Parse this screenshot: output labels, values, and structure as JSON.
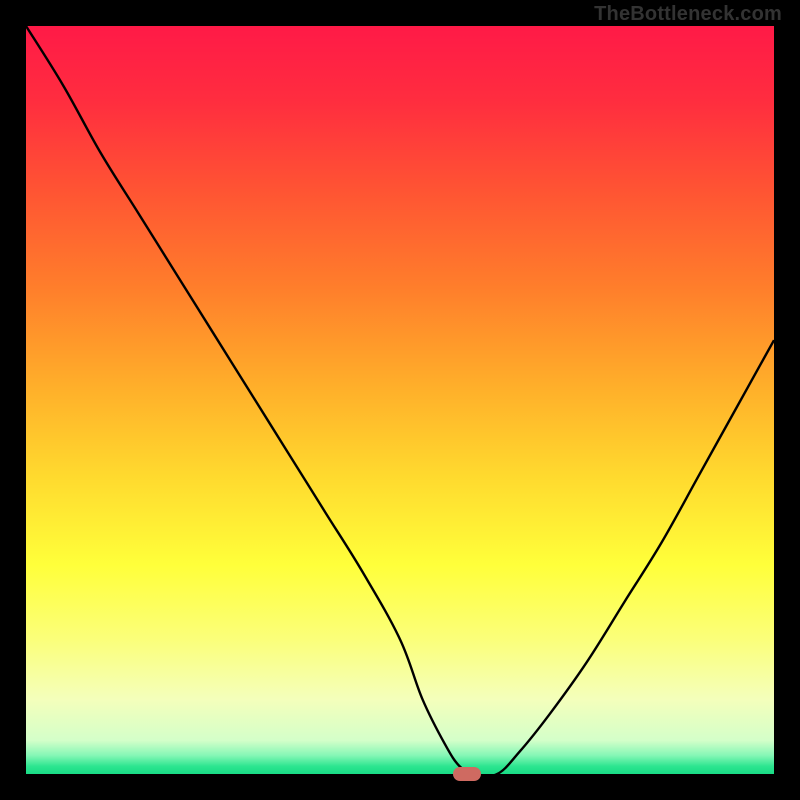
{
  "watermark": "TheBottleneck.com",
  "colors": {
    "background": "#000000",
    "gradient_stops": [
      {
        "offset": 0.0,
        "color": "#ff1a47"
      },
      {
        "offset": 0.1,
        "color": "#ff2d3f"
      },
      {
        "offset": 0.22,
        "color": "#ff5433"
      },
      {
        "offset": 0.35,
        "color": "#ff7e2b"
      },
      {
        "offset": 0.48,
        "color": "#ffae2a"
      },
      {
        "offset": 0.6,
        "color": "#ffd92e"
      },
      {
        "offset": 0.72,
        "color": "#ffff3a"
      },
      {
        "offset": 0.82,
        "color": "#fbff7a"
      },
      {
        "offset": 0.9,
        "color": "#f4ffbb"
      },
      {
        "offset": 0.955,
        "color": "#d4ffc9"
      },
      {
        "offset": 0.975,
        "color": "#86f7b6"
      },
      {
        "offset": 0.99,
        "color": "#2be58f"
      },
      {
        "offset": 1.0,
        "color": "#19db86"
      }
    ],
    "curve": "#000000",
    "marker": "#cf6a61"
  },
  "chart_data": {
    "type": "line",
    "title": "",
    "xlabel": "",
    "ylabel": "",
    "xlim": [
      0,
      100
    ],
    "ylim": [
      0,
      100
    ],
    "series": [
      {
        "name": "bottleneck-curve",
        "x": [
          0,
          5,
          10,
          15,
          20,
          25,
          30,
          35,
          40,
          45,
          50,
          53,
          56,
          58,
          60,
          63,
          66,
          70,
          75,
          80,
          85,
          90,
          95,
          100
        ],
        "y": [
          100,
          92,
          83,
          75,
          67,
          59,
          51,
          43,
          35,
          27,
          18,
          10,
          4,
          1,
          0,
          0,
          3,
          8,
          15,
          23,
          31,
          40,
          49,
          58
        ]
      }
    ],
    "marker": {
      "x": 59,
      "y": 0
    },
    "legend": false,
    "grid": false
  }
}
